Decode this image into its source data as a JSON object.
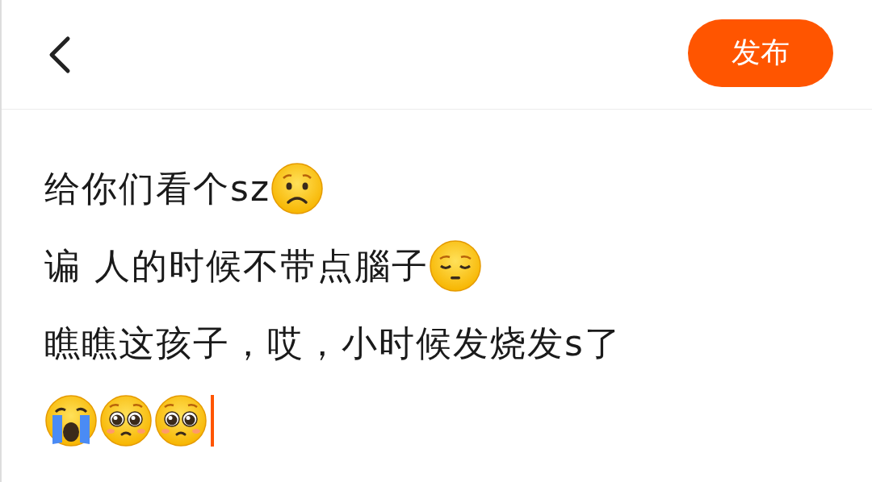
{
  "header": {
    "publish_button": "发布"
  },
  "editor": {
    "focused": true,
    "lines": [
      {
        "text": "给你们看个sz",
        "emoji": [
          {
            "kind": "worried"
          }
        ]
      },
      {
        "text": "谝 人的时候不带点腦子",
        "emoji": [
          {
            "kind": "pensive"
          }
        ]
      },
      {
        "text": "瞧瞧这孩子，哎，小时候发烧发s了"
      },
      {
        "emoji": [
          {
            "kind": "crying"
          },
          {
            "kind": "pleading"
          },
          {
            "kind": "pleading"
          }
        ]
      }
    ]
  }
}
